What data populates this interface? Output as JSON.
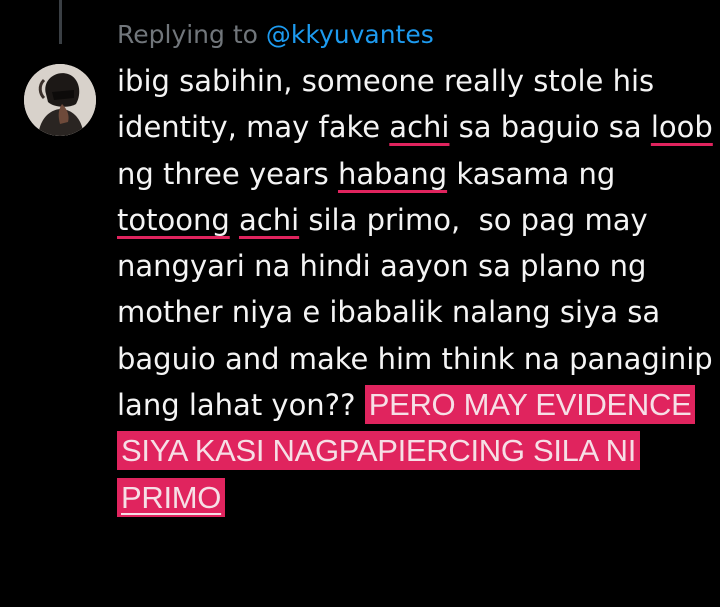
{
  "reply": {
    "prefix": "Replying to ",
    "handle": "@kkyuvantes"
  },
  "avatar": {
    "alt": "user avatar"
  },
  "tweet": {
    "segments": [
      {
        "text": "ibig sabihin, someone really stole his\nidentity, may fake ",
        "style": "normal"
      },
      {
        "text": "achi",
        "style": "underline"
      },
      {
        "text": " sa baguio sa ",
        "style": "normal"
      },
      {
        "text": "loob",
        "style": "underline"
      },
      {
        "text": "\nng three years ",
        "style": "normal"
      },
      {
        "text": "habang",
        "style": "underline"
      },
      {
        "text": " kasama ng\n",
        "style": "normal"
      },
      {
        "text": "totoong",
        "style": "underline"
      },
      {
        "text": " ",
        "style": "normal"
      },
      {
        "text": "achi",
        "style": "underline"
      },
      {
        "text": " sila primo,  so pag may\nnangyari na hindi aayon sa plano ng\nmother niya e ibabalik nalang siya sa\nbaguio and make him think na panaginip\nlang lahat yon?? ",
        "style": "normal"
      },
      {
        "text": "PERO MAY EVIDENCE\nSIYA KASI NAGPAPIERCING SILA NI\n",
        "style": "highlight"
      },
      {
        "text": "PRIMO",
        "style": "highlight-underline"
      }
    ]
  },
  "colors": {
    "background": "#000000",
    "muted_text": "#71767b",
    "link": "#1d9bf0",
    "body_text": "#f4f4f4",
    "highlight": "#e0245e",
    "underline": "#e0245e"
  }
}
